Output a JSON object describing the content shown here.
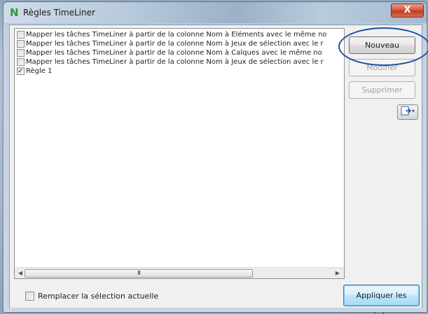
{
  "window": {
    "title": "Règles TimeLiner",
    "app_icon": "N",
    "close_label": "X"
  },
  "rules": [
    {
      "label": "Mapper les tâches TimeLiner à partir de la colonne Nom à Eléments avec le même no",
      "checked": false
    },
    {
      "label": "Mapper les tâches TimeLiner à partir de la colonne Nom à Jeux de sélection avec le r",
      "checked": false
    },
    {
      "label": "Mapper les tâches TimeLiner à partir de la colonne Nom à Calques avec le même no",
      "checked": false
    },
    {
      "label": "Mapper les tâches TimeLiner à partir de la colonne Nom à Jeux de sélection avec le r",
      "checked": false
    },
    {
      "label": "Règle 1",
      "checked": true
    }
  ],
  "scrollbar": {
    "left_arrow": "◀",
    "right_arrow": "▶",
    "thumb_grip": "III"
  },
  "buttons": {
    "new_label": "Nouveau",
    "edit_label": "Modifier",
    "delete_label": "Supprimer",
    "export_icon": "export-icon"
  },
  "bottom": {
    "replace_selection_label": "Remplacer la sélection actuelle",
    "replace_selection_checked": false,
    "apply_label": "Appliquer les règles"
  },
  "colors": {
    "highlight_oval": "#1a4fa0",
    "check_mark": "#1d3a8a"
  }
}
